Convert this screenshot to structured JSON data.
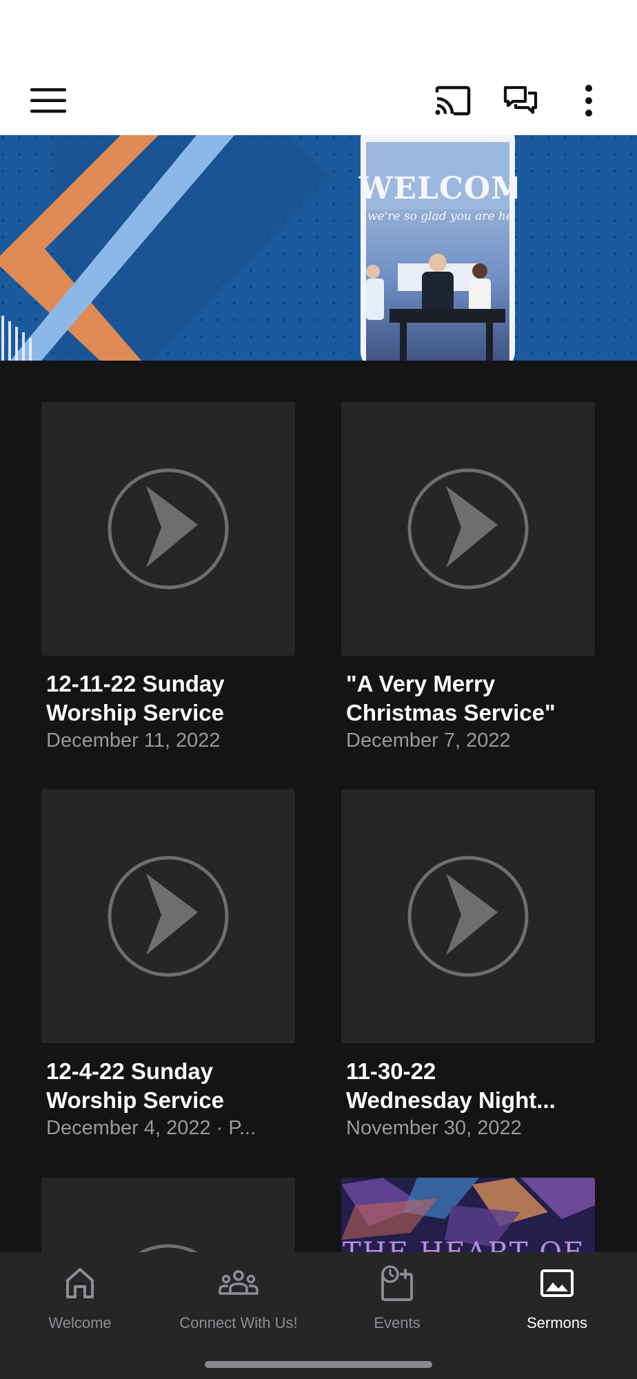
{
  "app_bar": {
    "menu_icon": "hamburger-menu-icon",
    "cast_icon": "cast-icon",
    "chat_icon": "chat-bubbles-icon",
    "more_icon": "more-vertical-icon"
  },
  "banner": {
    "welcome_text": "WELCOM",
    "script_text": "we're so glad you are here"
  },
  "sermons": [
    {
      "title": "12-11-22 Sunday\nWorship Service",
      "subtitle": "December 11, 2022"
    },
    {
      "title": "\"A Very Merry\nChristmas Service\"",
      "subtitle": "December 7, 2022"
    },
    {
      "title": "12-4-22 Sunday\nWorship Service",
      "subtitle": "December 4, 2022 · P..."
    },
    {
      "title": "11-30-22\nWednesday Night...",
      "subtitle": "November 30, 2022"
    }
  ],
  "partial_thumb_text": "THE HEART OF A",
  "bottom_nav": {
    "items": [
      {
        "label": "Welcome",
        "icon": "home-icon",
        "active": false
      },
      {
        "label": "Connect With Us!",
        "icon": "people-group-icon",
        "active": false
      },
      {
        "label": "Events",
        "icon": "calendar-clock-icon",
        "active": false
      },
      {
        "label": "Sermons",
        "icon": "image-icon",
        "active": true
      }
    ]
  },
  "colors": {
    "background": "#141416",
    "card": "#262628",
    "nav_background": "#262628",
    "banner_blue": "#1c5a9e",
    "banner_orange": "#e08a55",
    "banner_light_blue": "#8cb8e8"
  }
}
